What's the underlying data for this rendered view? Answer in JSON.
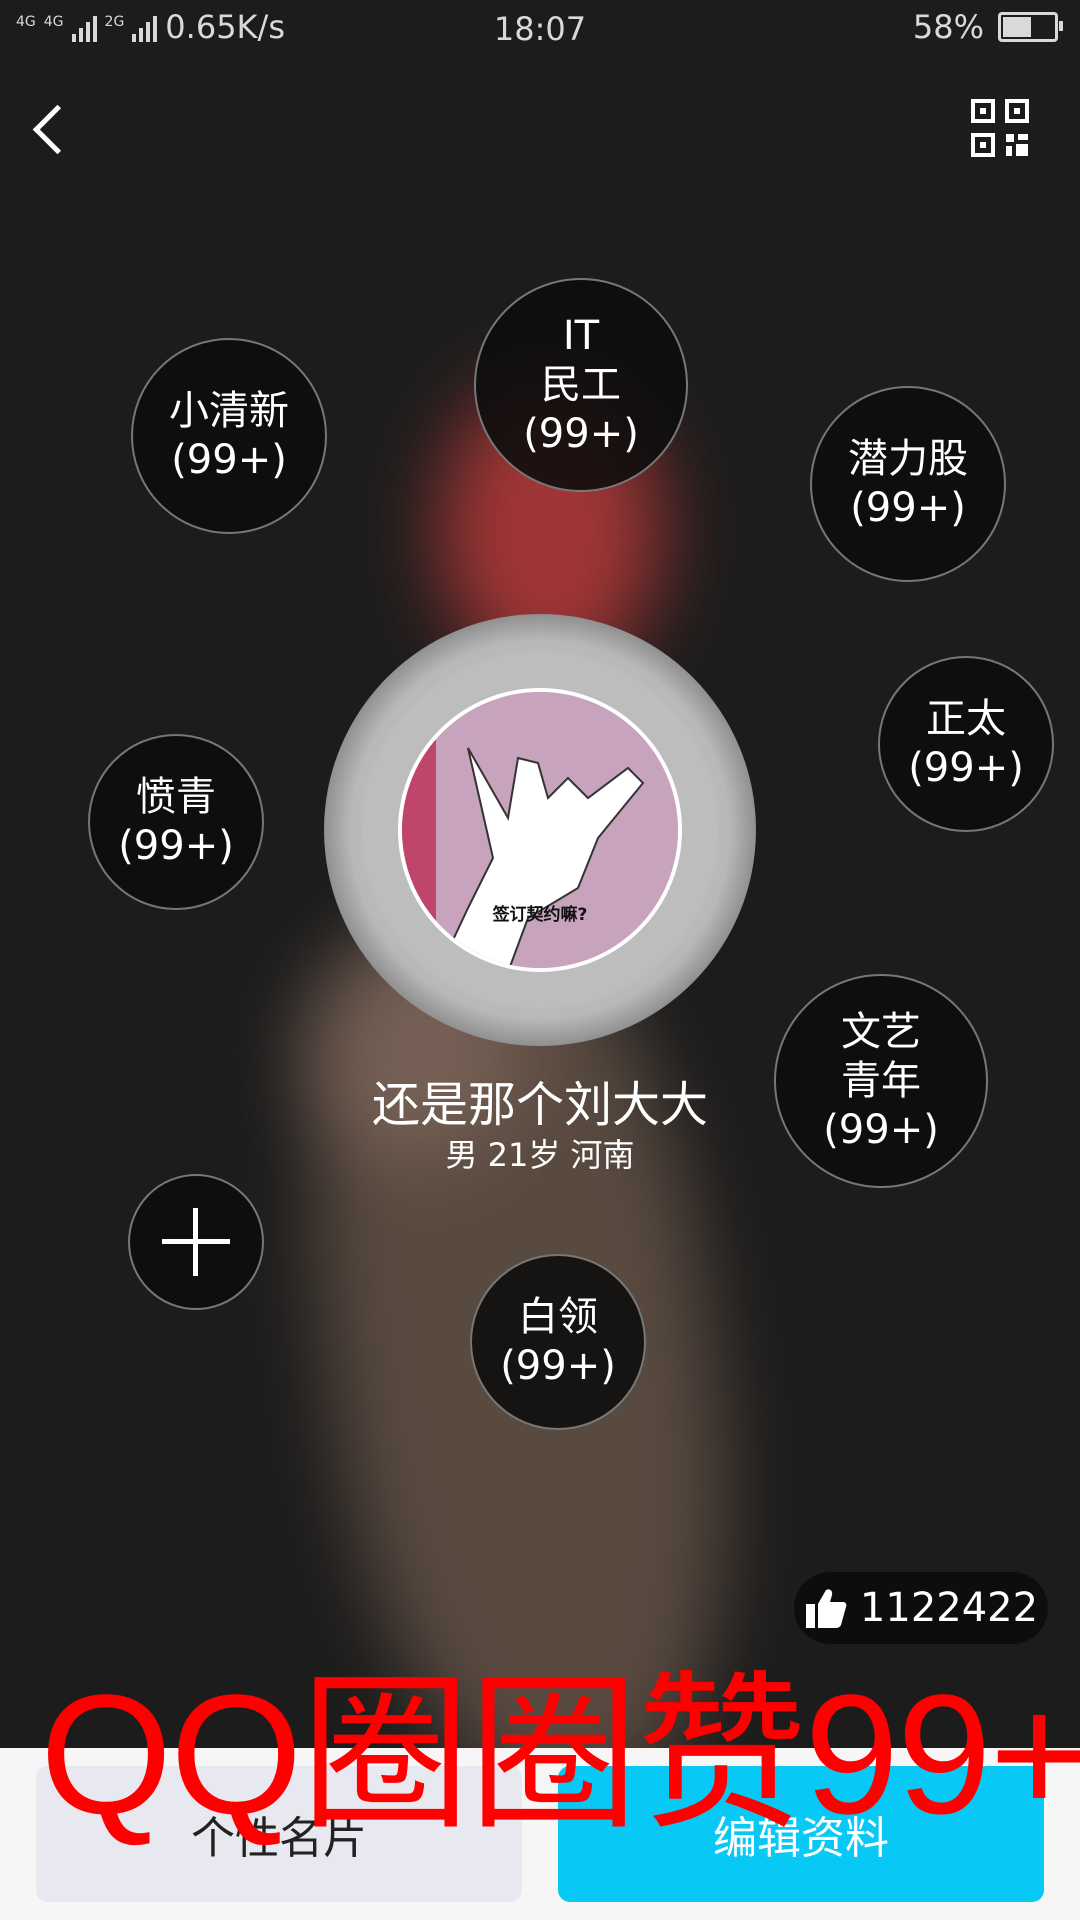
{
  "status_bar": {
    "network_1": "4G",
    "network_2": "4G",
    "network_3": "2G",
    "speed": "0.65K/s",
    "time": "18:07",
    "battery_percent": "58%",
    "battery_level": 0.58
  },
  "header": {
    "back_icon": "chevron-left-icon",
    "qr_icon": "qr-code-icon"
  },
  "tags": [
    {
      "label": "小清新",
      "count": "(99+)"
    },
    {
      "label_line1": "IT",
      "label_line2": "民工",
      "count": "(99+)"
    },
    {
      "label": "潜力股",
      "count": "(99+)"
    },
    {
      "label": "正太",
      "count": "(99+)"
    },
    {
      "label": "愤青",
      "count": "(99+)"
    },
    {
      "label_line1": "文艺",
      "label_line2": "青年",
      "count": "(99+)"
    },
    {
      "label": "白领",
      "count": "(99+)"
    }
  ],
  "profile": {
    "avatar_caption": "签订契约嘛?",
    "name": "还是那个刘大大",
    "info": "男 21岁 河南"
  },
  "likes": {
    "icon": "thumbs-up-icon",
    "count": "1122422"
  },
  "bottom": {
    "card_button": "个性名片",
    "edit_button": "编辑资料"
  },
  "watermark": "QQ圈圈赞99+",
  "colors": {
    "accent": "#08c9f5",
    "watermark": "#ff0000",
    "background": "#1c1c1c"
  }
}
